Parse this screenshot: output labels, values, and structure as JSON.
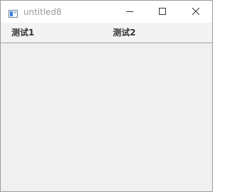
{
  "window": {
    "title": "untitled8"
  },
  "title_bar": {
    "app_icon": "window-app-icon",
    "minimize_icon": "minimize-icon",
    "maximize_icon": "maximize-icon",
    "close_icon": "close-icon"
  },
  "tabs": [
    {
      "label": "测试1"
    },
    {
      "label": "测试2"
    }
  ],
  "colors": {
    "title_text": "#999999",
    "tab_text": "#333333",
    "background": "#f0f0f0",
    "titlebar_background": "#ffffff",
    "separator": "#a0a0a0"
  }
}
